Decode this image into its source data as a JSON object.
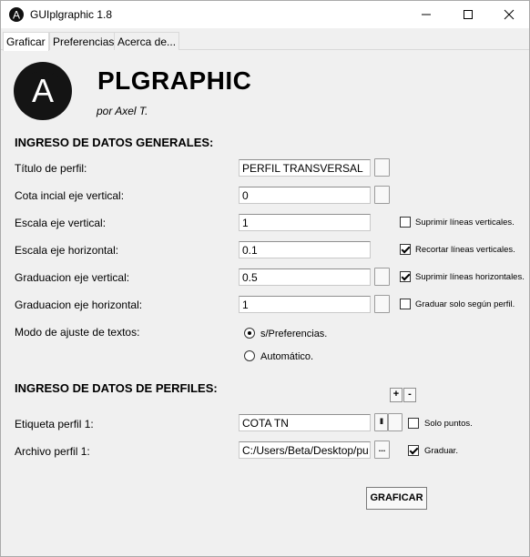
{
  "window": {
    "title": "GUIplgraphic 1.8",
    "controls": {
      "minimize": "─",
      "maximize": "☐",
      "close": "✕"
    }
  },
  "tabs": [
    "Graficar",
    "Preferencias",
    "Acerca de..."
  ],
  "header": {
    "logo_letter": "A",
    "app_name": "PLGRAPHIC",
    "author": "por Axel T."
  },
  "general": {
    "heading": "INGRESO DE DATOS GENERALES:",
    "fields": [
      {
        "label": "Título de perfil:",
        "value": "PERFIL TRANSVERSAL"
      },
      {
        "label": "Cota incial eje vertical:",
        "value": "0"
      },
      {
        "label": "Escala eje vertical:",
        "value": "1"
      },
      {
        "label": "Escala eje horizontal:",
        "value": "0.1"
      },
      {
        "label": "Graduacion eje vertical:",
        "value": "0.5"
      },
      {
        "label": "Graduacion eje horizontal:",
        "value": "1"
      }
    ],
    "options": [
      {
        "label": "Suprimir líneas verticales.",
        "checked": false
      },
      {
        "label": "Recortar líneas verticales.",
        "checked": true
      },
      {
        "label": "Suprimir líneas horizontales.",
        "checked": true
      },
      {
        "label": "Graduar solo según perfil.",
        "checked": false
      }
    ],
    "text_mode": {
      "label": "Modo de ajuste de textos:",
      "options": [
        "s/Preferencias.",
        "Automático."
      ],
      "selected": "s/Preferencias."
    }
  },
  "profiles": {
    "heading": "INGRESO DE DATOS DE PERFILES:",
    "add_label": "+",
    "remove_label": "-",
    "tag_label": "Etiqueta perfil 1:",
    "tag_value": "COTA TN",
    "pause_label": "II",
    "solo_puntos_label": "Solo puntos.",
    "solo_puntos_checked": false,
    "file_label": "Archivo perfil 1:",
    "file_value": "C:/Users/Beta/Desktop/pu",
    "browse_label": "...",
    "graduar_label": "Graduar.",
    "graduar_checked": true
  },
  "submit_label": "GRAFICAR"
}
